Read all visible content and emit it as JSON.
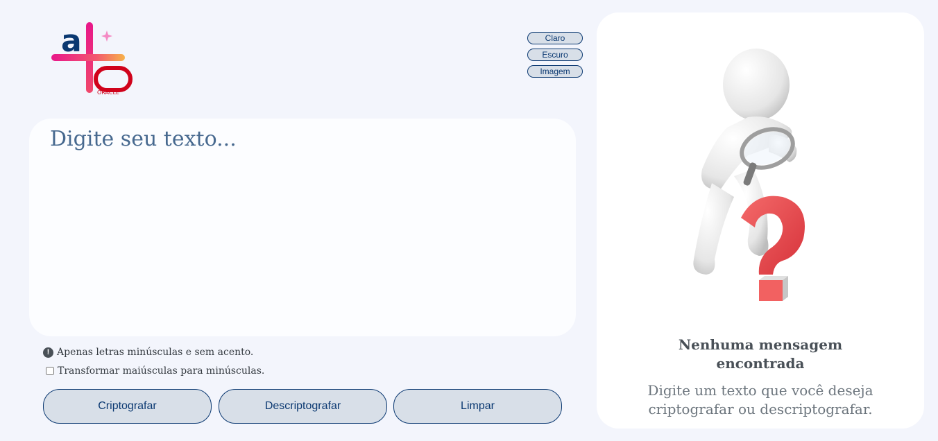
{
  "header": {
    "logo_alt": "Alura Oracle logo",
    "logo_text": "ORACLE"
  },
  "theme": {
    "light_label": "Claro",
    "dark_label": "Escuro",
    "image_label": "Imagem"
  },
  "input": {
    "placeholder": "Digite seu texto...",
    "value": ""
  },
  "hints": {
    "info_text": "Apenas letras minúsculas e sem acento.",
    "checkbox_label": "Transformar maiúsculas para minúsculas.",
    "checkbox_checked": false
  },
  "actions": {
    "encrypt_label": "Criptografar",
    "decrypt_label": "Descriptografar",
    "clear_label": "Limpar"
  },
  "output": {
    "empty_title": "Nenhuma mensagem encontrada",
    "empty_description": "Digite um texto que você deseja criptografar ou descriptografar.",
    "illustration": "person-magnifying-glass-question-mark"
  },
  "colors": {
    "primary": "#0a3871",
    "background": "#f3f5fc",
    "button_bg": "#d8dfe8",
    "question_red": "#e9424a"
  }
}
